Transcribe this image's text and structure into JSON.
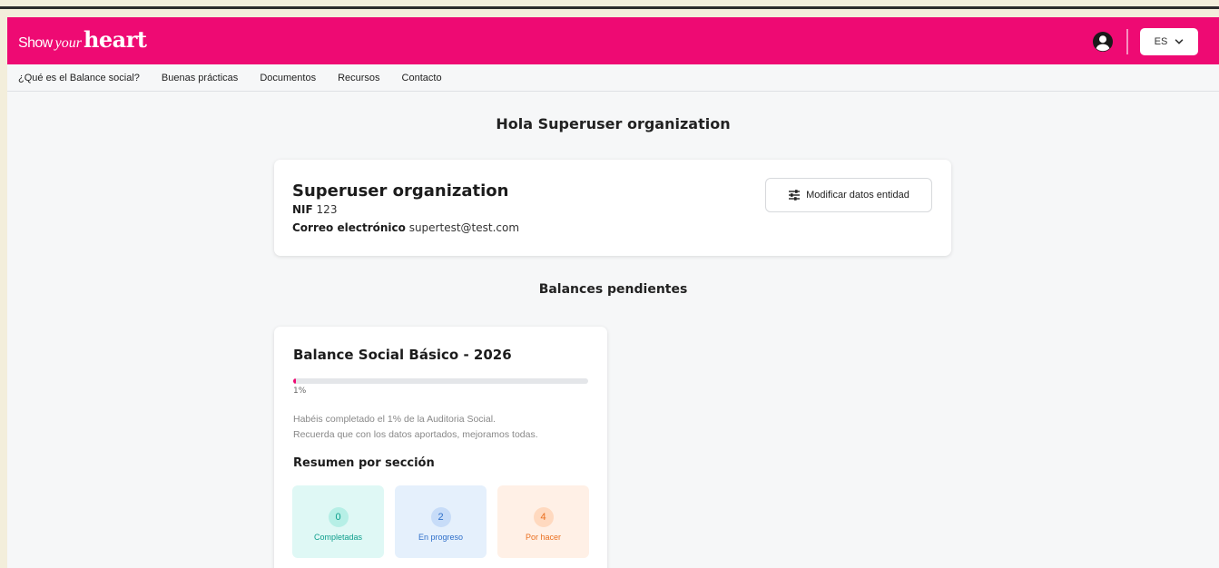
{
  "header": {
    "logo": {
      "part1": "Show",
      "part2": "your",
      "part3": "heart"
    },
    "user_icon": "user-circle-icon",
    "language": {
      "selected": "ES",
      "icon": "chevron-down-icon"
    },
    "color": "#ee0a73"
  },
  "nav": {
    "items": [
      {
        "label": "¿Qué es el Balance social?"
      },
      {
        "label": "Buenas prácticas"
      },
      {
        "label": "Documentos"
      },
      {
        "label": "Recursos"
      },
      {
        "label": "Contacto"
      }
    ]
  },
  "greeting": "Hola Superuser organization",
  "organization": {
    "name": "Superuser organization",
    "nif_label": "NIF",
    "nif_value": "123",
    "email_label": "Correo electrónico",
    "email_value": "supertest@test.com",
    "edit_button": {
      "label": "Modificar datos entidad",
      "icon": "sliders-icon"
    }
  },
  "pending_title": "Balances pendientes",
  "balance": {
    "title": "Balance Social Básico - 2026",
    "progress_percent": 1,
    "progress_label": "1%",
    "description_line1": "Habéis completado el 1% de la Auditoria Social.",
    "description_line2": "Recuerda que con los datos aportados, mejoramos todas.",
    "summary_title": "Resumen por sección",
    "stats": [
      {
        "value": "0",
        "label": "Completadas",
        "color": "#0d9e8c"
      },
      {
        "value": "2",
        "label": "En progreso",
        "color": "#2f6fc9"
      },
      {
        "value": "4",
        "label": "Por hacer",
        "color": "#ea6f1f"
      }
    ]
  }
}
